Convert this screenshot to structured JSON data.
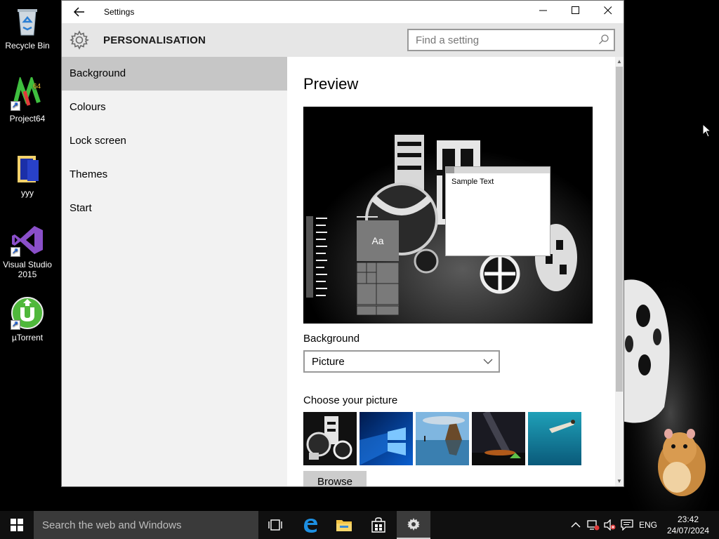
{
  "desktop": {
    "icons": [
      {
        "label": "Recycle Bin"
      },
      {
        "label": "Project64"
      },
      {
        "label": "yyy"
      },
      {
        "label": "Visual Studio 2015"
      },
      {
        "label": "µTorrent"
      }
    ]
  },
  "window": {
    "title": "Settings",
    "header": "PERSONALISATION",
    "search_placeholder": "Find a setting",
    "nav": [
      {
        "label": "Background",
        "selected": true
      },
      {
        "label": "Colours"
      },
      {
        "label": "Lock screen"
      },
      {
        "label": "Themes"
      },
      {
        "label": "Start"
      }
    ],
    "content": {
      "preview_title": "Preview",
      "sample_text": "Sample Text",
      "tile_label": "Aa",
      "background_label": "Background",
      "background_value": "Picture",
      "choose_label": "Choose your picture",
      "browse_label": "Browse"
    }
  },
  "taskbar": {
    "search_placeholder": "Search the web and Windows",
    "language": "ENG",
    "time": "23:42",
    "date": "24/07/2024"
  },
  "colors": {
    "accent": "#0078d7",
    "nav_selected": "#c6c6c6",
    "header_bg": "#e6e6e6",
    "taskbar": "#101010"
  }
}
